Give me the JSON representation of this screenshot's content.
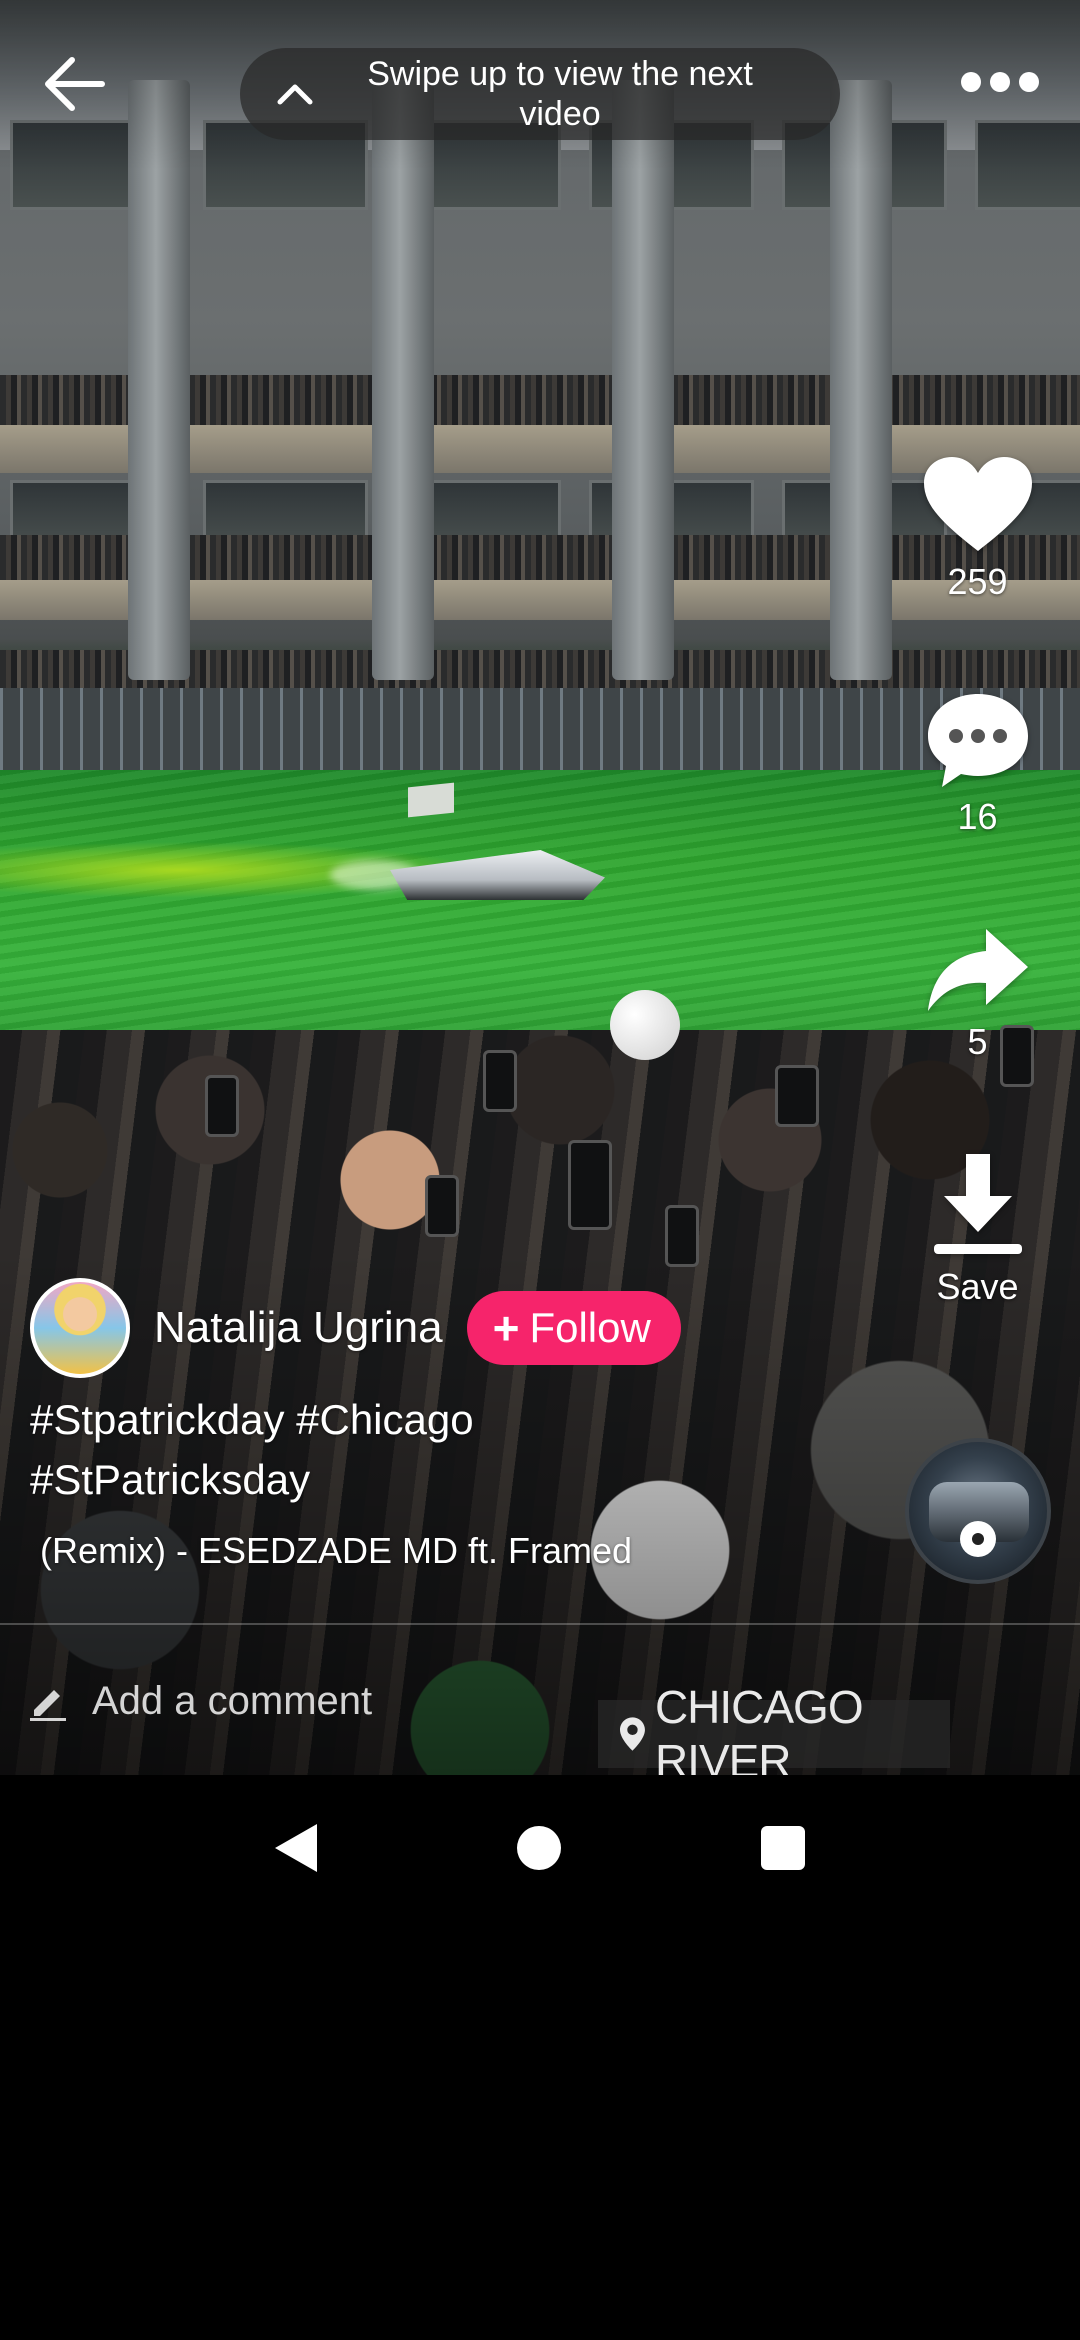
{
  "top_bar": {
    "back_icon": "arrow-left-icon",
    "swipe_hint": "Swipe up to view the next video",
    "swipe_icon": "chevron-up-icon",
    "more_icon": "more-dots-icon"
  },
  "actions": {
    "like": {
      "icon": "heart-icon",
      "count": "259"
    },
    "comment": {
      "icon": "comment-bubble-icon",
      "count": "16"
    },
    "share": {
      "icon": "share-arrow-icon",
      "count": "5"
    },
    "save": {
      "icon": "download-icon",
      "label": "Save"
    }
  },
  "author": {
    "name": "Natalija Ugrina",
    "follow_label": "Follow",
    "follow_color": "#f6246b"
  },
  "caption": {
    "line1": "#Stpatrickday #Chicago",
    "line2": "#StPatricksday"
  },
  "music": {
    "title": "(Remix) - ESEDZADE MD ft. Framed",
    "disc_icon": "music-disc-icon"
  },
  "comment_bar": {
    "icon": "pencil-icon",
    "placeholder": "Add a comment"
  },
  "video": {
    "location_sticker": "CHICAGO RIVER"
  },
  "system_nav": {
    "back_icon": "nav-back-icon",
    "home_icon": "nav-home-icon",
    "recents_icon": "nav-recents-icon"
  }
}
